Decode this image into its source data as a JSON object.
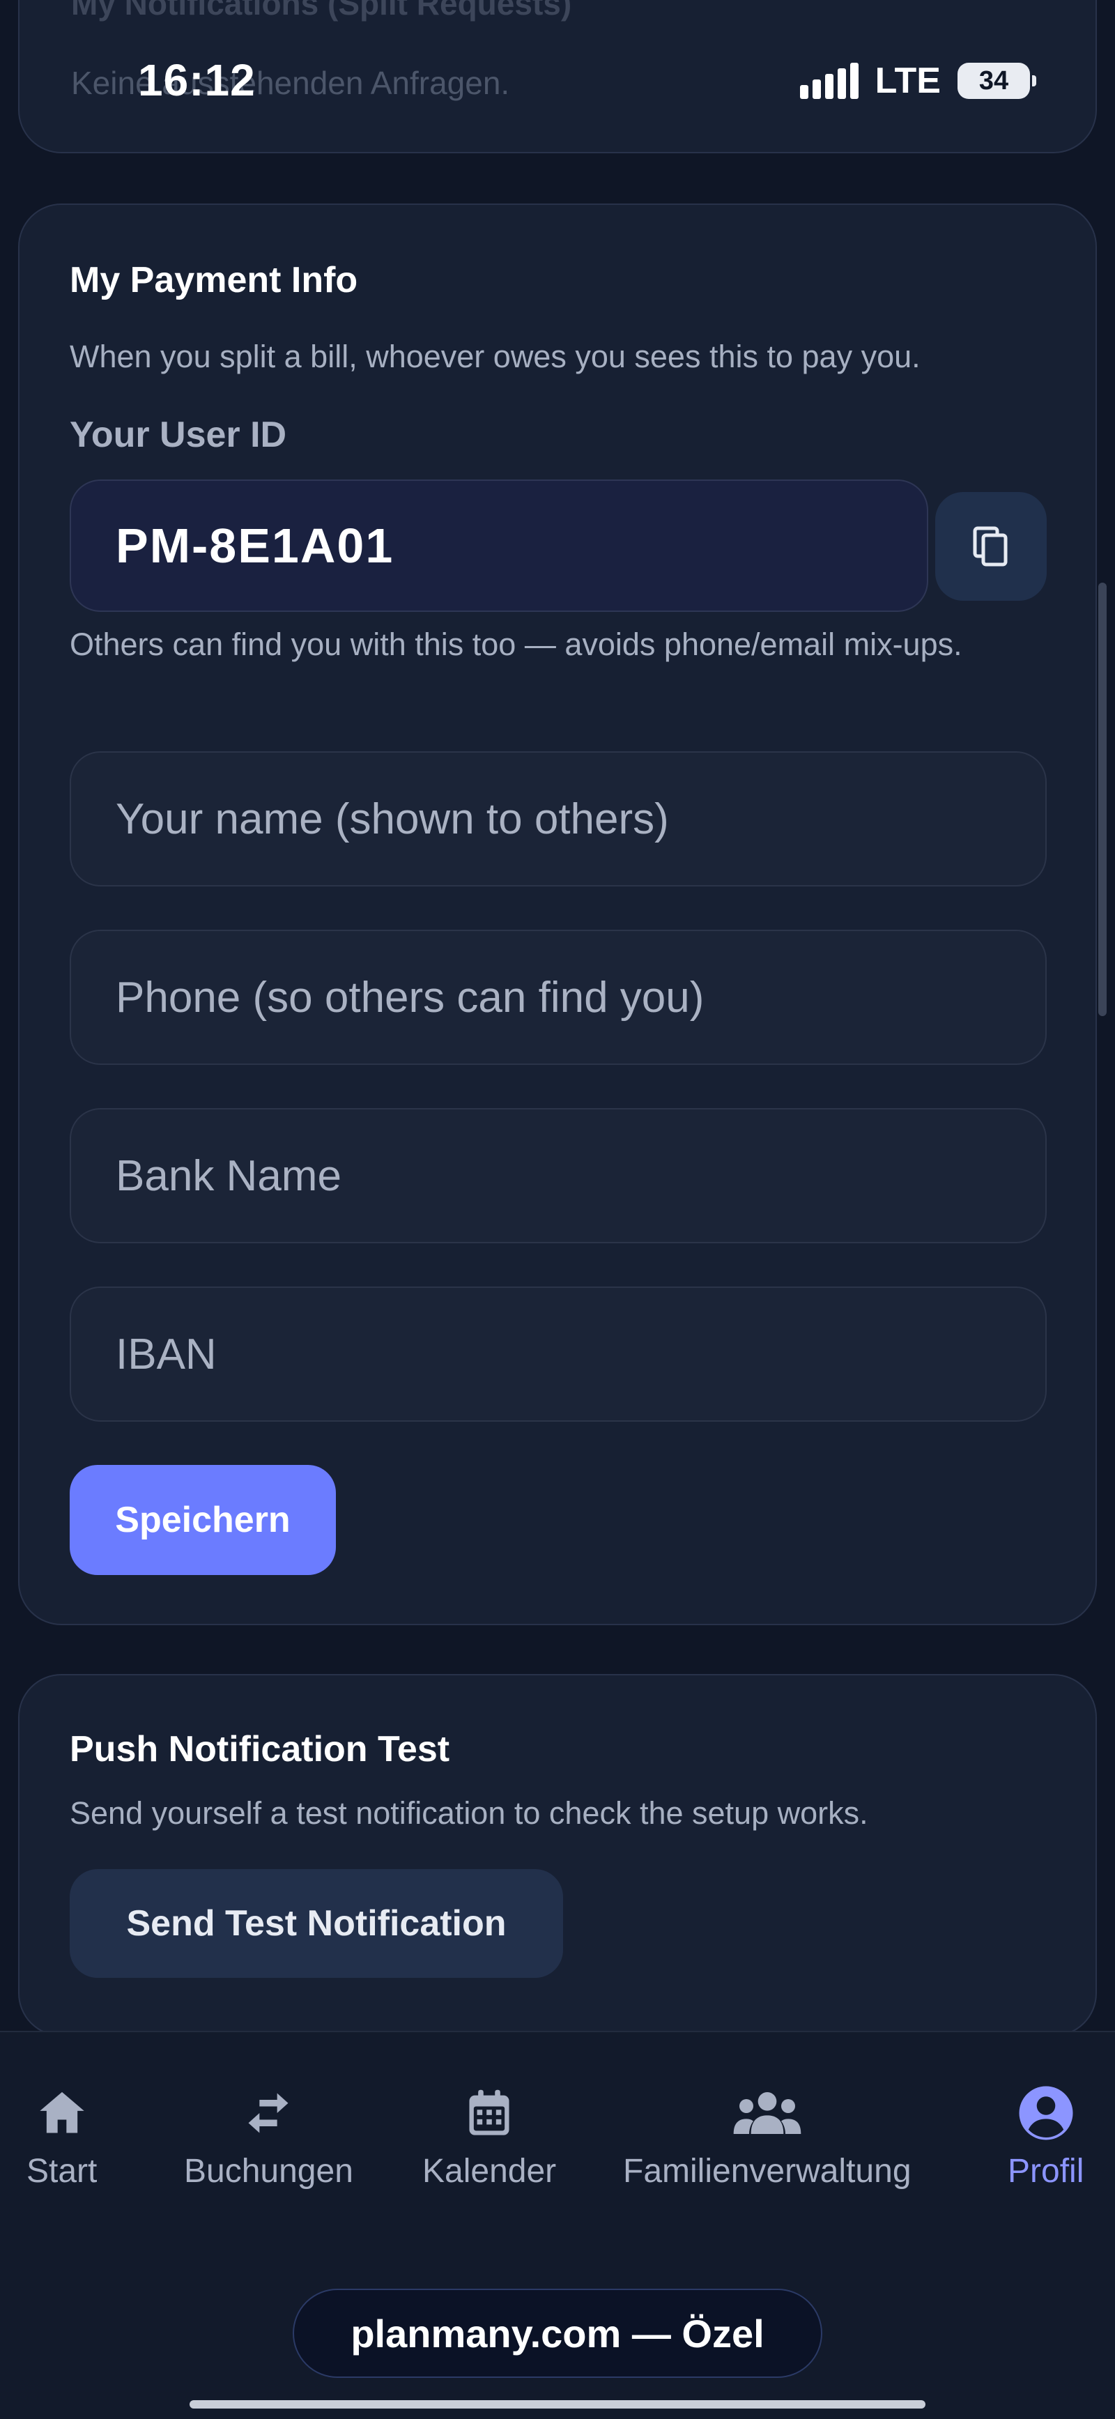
{
  "status_bar": {
    "time": "16:12",
    "network": "LTE",
    "battery": "34"
  },
  "notifications_card": {
    "title": "My Notifications (Split Requests)",
    "text": "Keine ausstehenden Anfragen."
  },
  "payment_card": {
    "title": "My Payment Info",
    "description": "When you split a bill, whoever owes you sees this to pay you.",
    "user_id_label": "Your User ID",
    "user_id_value": "PM-8E1A01",
    "user_id_note": "Others can find you with this too — avoids phone/email mix-ups.",
    "name_placeholder": "Your name (shown to others)",
    "phone_placeholder": "Phone (so others can find you)",
    "bank_placeholder": "Bank Name",
    "iban_placeholder": "IBAN",
    "save_label": "Speichern"
  },
  "push_card": {
    "title": "Push Notification Test",
    "description": "Send yourself a test notification to check the setup works.",
    "button_label": "Send Test Notification"
  },
  "bottom_nav": {
    "items": [
      {
        "label": "Start",
        "icon": "home-icon"
      },
      {
        "label": "Buchungen",
        "icon": "swap-arrows-icon"
      },
      {
        "label": "Kalender",
        "icon": "calendar-icon"
      },
      {
        "label": "Familienverwaltung",
        "icon": "group-icon"
      },
      {
        "label": "Profil",
        "icon": "account-circle-icon"
      }
    ],
    "active": "Profil"
  },
  "browser_bar": {
    "url_label": "planmany.com — Özel"
  },
  "colors": {
    "background": "#0f1626",
    "card": "#172033",
    "accent": "#6b7cff",
    "active_nav": "#8c95ff"
  }
}
